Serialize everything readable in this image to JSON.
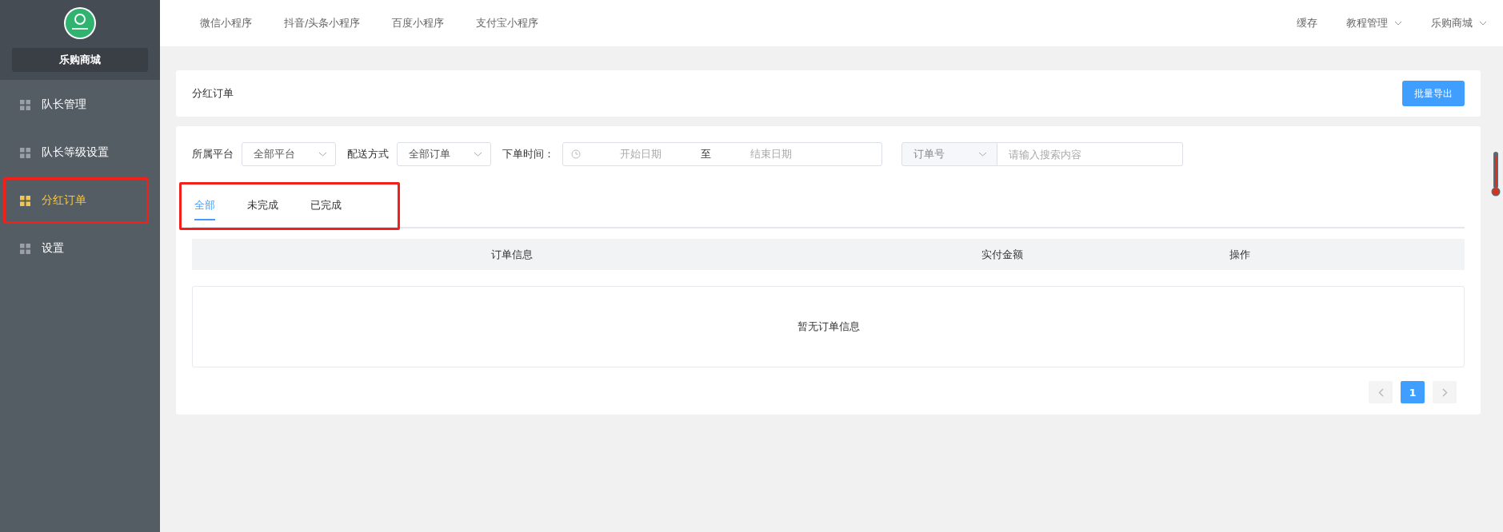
{
  "sidebar": {
    "brand": "乐购商城",
    "items": [
      {
        "label": "队长管理",
        "selected": false,
        "highlighted": false
      },
      {
        "label": "队长等级设置",
        "selected": false,
        "highlighted": false
      },
      {
        "label": "分红订单",
        "selected": true,
        "highlighted": true
      },
      {
        "label": "设置",
        "selected": false,
        "highlighted": false
      }
    ]
  },
  "topbar": {
    "tabs": [
      "微信小程序",
      "抖音/头条小程序",
      "百度小程序",
      "支付宝小程序"
    ],
    "right": [
      {
        "label": "缓存",
        "dropdown": false
      },
      {
        "label": "教程管理",
        "dropdown": true
      },
      {
        "label": "乐购商城",
        "dropdown": true
      }
    ]
  },
  "header": {
    "title": "分红订单",
    "export_button": "批量导出"
  },
  "filters": {
    "platform_label": "所属平台",
    "platform_value": "全部平台",
    "delivery_label": "配送方式",
    "delivery_value": "全部订单",
    "time_label": "下单时间：",
    "start_placeholder": "开始日期",
    "range_separator": "至",
    "end_placeholder": "结束日期",
    "search_type": "订单号",
    "search_placeholder": "请输入搜索内容"
  },
  "tabs_highlighted": true,
  "tabs": [
    {
      "label": "全部",
      "selected": true
    },
    {
      "label": "未完成",
      "selected": false
    },
    {
      "label": "已完成",
      "selected": false
    }
  ],
  "table": {
    "columns": [
      "订单信息",
      "实付金额",
      "操作"
    ],
    "empty_text": "暂无订单信息"
  },
  "pagination": {
    "pages": [
      {
        "label": "1",
        "selected": true
      }
    ]
  }
}
